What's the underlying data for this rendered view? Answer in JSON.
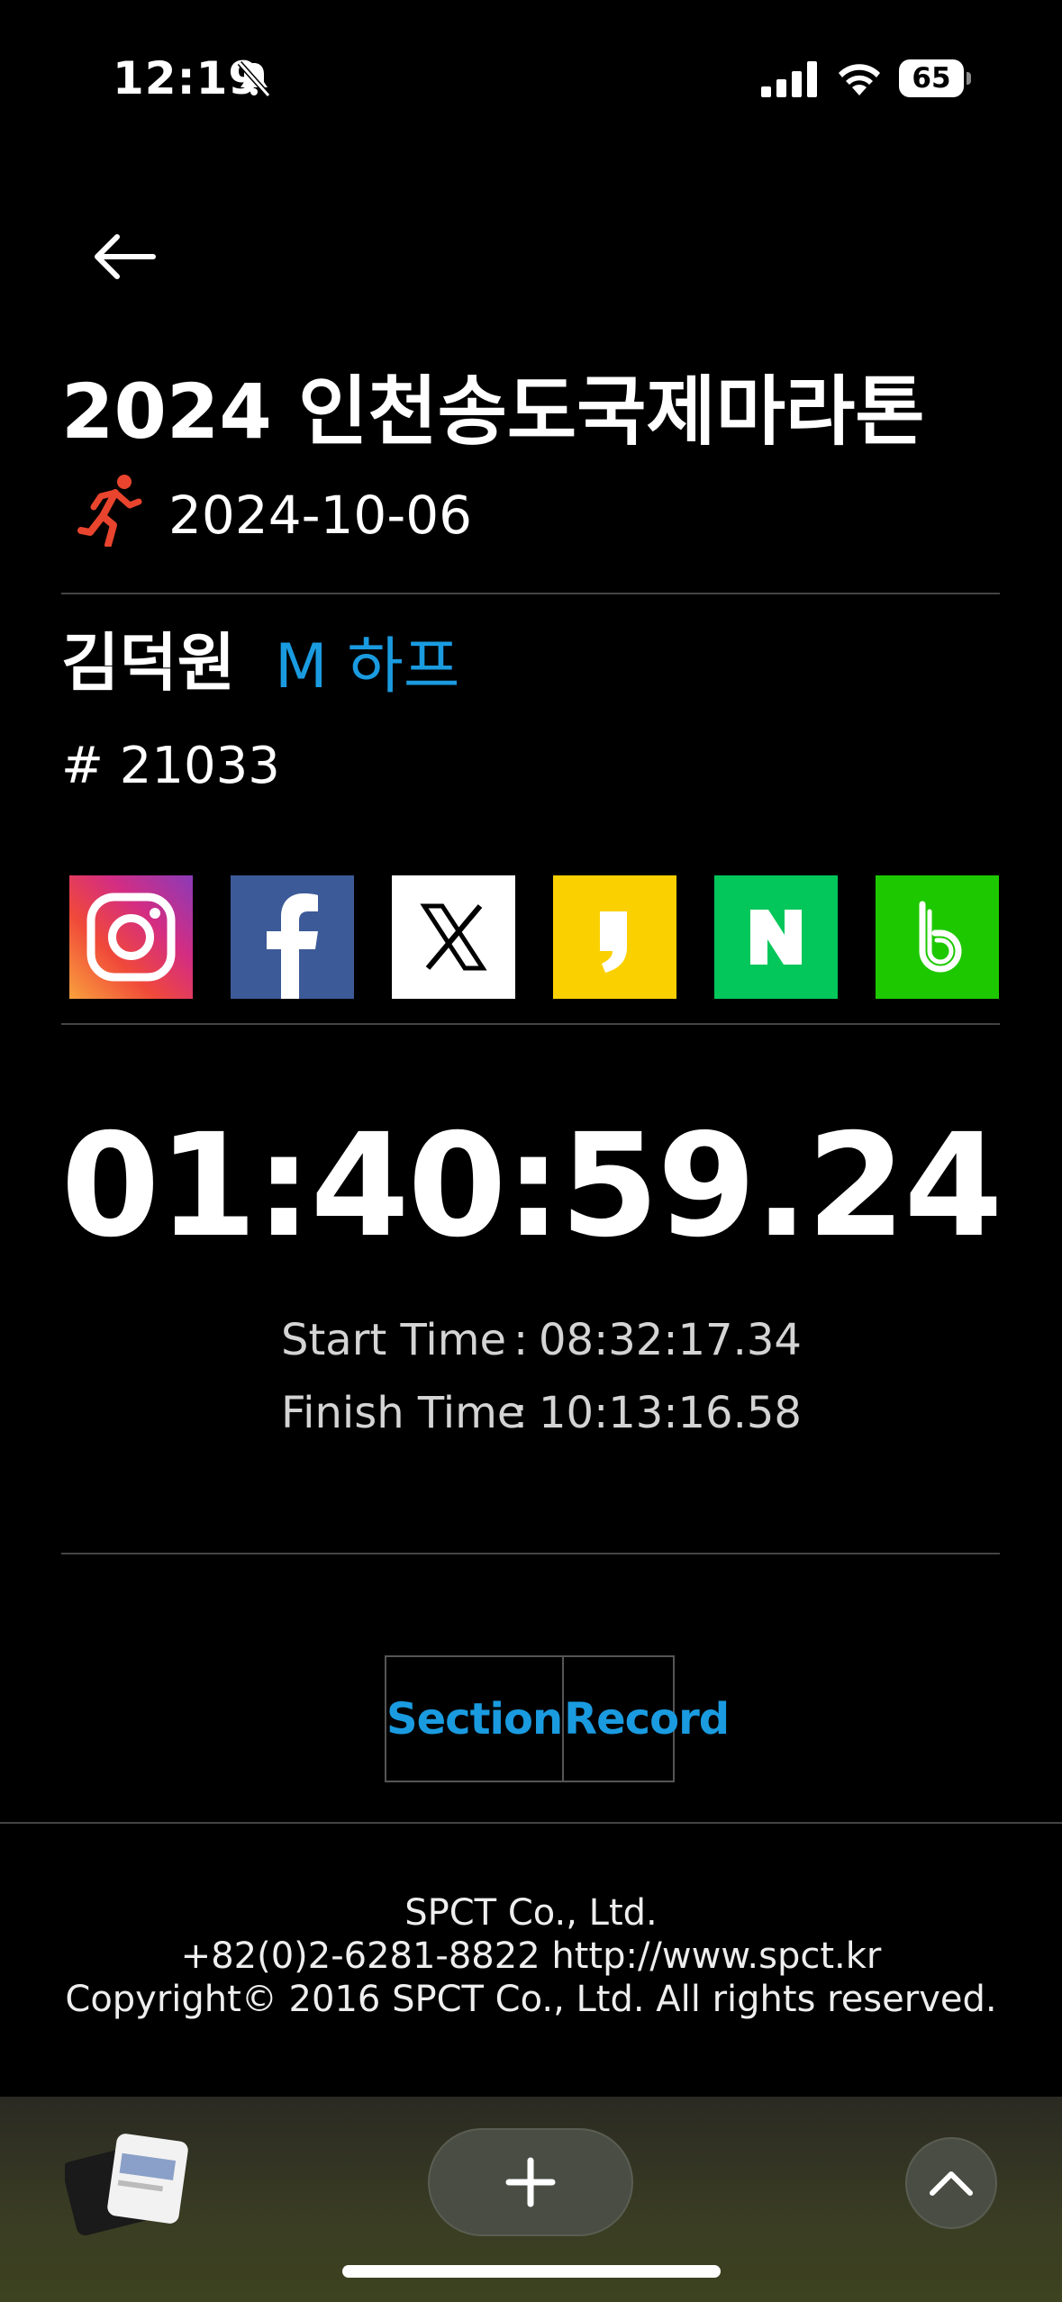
{
  "status_bar": {
    "time": "12:19",
    "battery": "65"
  },
  "event": {
    "title": "2024 인천송도국제마라톤",
    "date": "2024-10-06"
  },
  "runner": {
    "name": "김덕원",
    "category": "M 하프",
    "bib": "# 21033"
  },
  "share": [
    {
      "name": "instagram-icon"
    },
    {
      "name": "facebook-icon"
    },
    {
      "name": "x-icon"
    },
    {
      "name": "kakaostory-icon"
    },
    {
      "name": "naver-icon"
    },
    {
      "name": "band-icon"
    }
  ],
  "result": {
    "total_time": "01:40:59.24",
    "start_label": "Start Time",
    "start_value": "08:32:17.34",
    "finish_label": "Finish Time",
    "finish_value": "10:13:16.58",
    "separator": ":"
  },
  "tabs": {
    "section": "Section",
    "record": "Record"
  },
  "footer": {
    "company": "SPCT Co., Ltd.",
    "contact": "+82(0)2-6281-8822 http://www.spct.kr",
    "copyright": "Copyright© 2016 SPCT Co., Ltd. All rights reserved."
  },
  "colors": {
    "accent": "#1a9be0",
    "background": "#000000",
    "runner_icon": "#e8442e"
  }
}
